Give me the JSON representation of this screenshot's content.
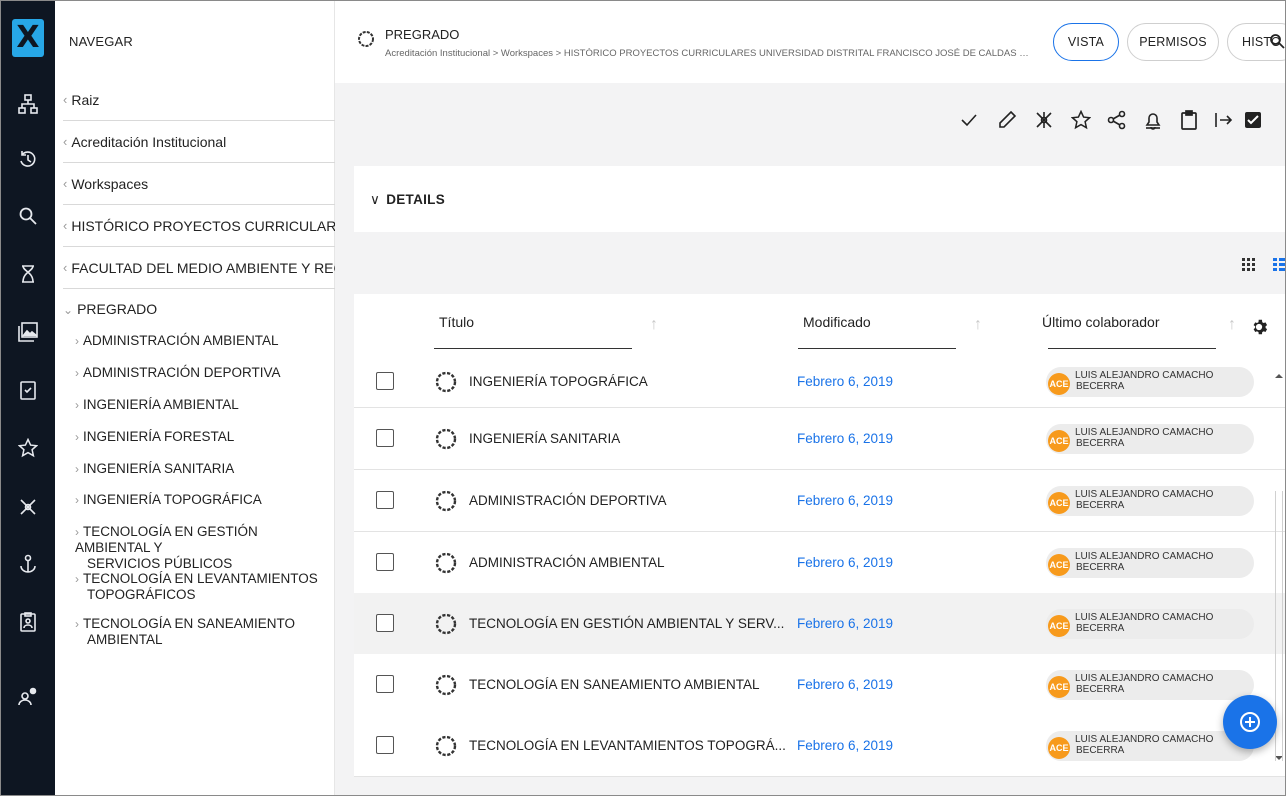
{
  "rail": {
    "logo": "X",
    "icons": [
      "hierarchy-icon",
      "history-icon",
      "search-icon",
      "hourglass-icon",
      "gallery-icon",
      "checklist-icon",
      "star-icon",
      "network-icon",
      "anchor-user-icon",
      "clipboard-id-icon",
      "user-settings-icon"
    ]
  },
  "navigator": {
    "title": "NAVEGAR",
    "breadcrumbs": [
      {
        "label": "Raiz"
      },
      {
        "label": "Acreditación Institucional"
      },
      {
        "label": "Workspaces"
      },
      {
        "label": "HISTÓRICO PROYECTOS CURRICULARES U..."
      },
      {
        "label": "FACULTAD DEL MEDIO AMBIENTE Y RECU..."
      }
    ],
    "current": "PREGRADO",
    "children": [
      {
        "line1": "ADMINISTRACIÓN AMBIENTAL",
        "line2": ""
      },
      {
        "line1": "ADMINISTRACIÓN DEPORTIVA",
        "line2": ""
      },
      {
        "line1": "INGENIERÍA AMBIENTAL",
        "line2": ""
      },
      {
        "line1": "INGENIERÍA FORESTAL",
        "line2": ""
      },
      {
        "line1": "INGENIERÍA SANITARIA",
        "line2": ""
      },
      {
        "line1": "INGENIERÍA TOPOGRÁFICA",
        "line2": ""
      },
      {
        "line1": "TECNOLOGÍA EN GESTIÓN AMBIENTAL Y",
        "line2": "SERVICIOS PÚBLICOS"
      },
      {
        "line1": "TECNOLOGÍA EN LEVANTAMIENTOS",
        "line2": "TOPOGRÁFICOS"
      },
      {
        "line1": "TECNOLOGÍA EN SANEAMIENTO",
        "line2": "AMBIENTAL"
      }
    ]
  },
  "header": {
    "title": "PREGRADO",
    "path": "Acreditación Institucional > Workspaces > HISTÓRICO PROYECTOS CURRICULARES UNIVERSIDAD DISTRITAL FRANCISCO JOSÉ DE CALDAS > FACULTA...",
    "tabs": [
      {
        "label": "VISTA",
        "active": true
      },
      {
        "label": "PERMISOS",
        "active": false
      },
      {
        "label": "HISTO",
        "active": false
      }
    ]
  },
  "actions": [
    "check-icon",
    "pencil-icon",
    "network-icon",
    "star-icon",
    "share-icon",
    "bell-icon",
    "clipboard-icon",
    "export-icon",
    "checkbox-checked-icon"
  ],
  "details": {
    "label": "DETAILS"
  },
  "table": {
    "columns": {
      "title": "Título",
      "modified": "Modificado",
      "collaborator": "Último colaborador"
    },
    "rows": [
      {
        "title": "INGENIERÍA TOPOGRÁFICA",
        "modified": "Febrero 6, 2019",
        "initials": "ACE",
        "collab1": "LUIS ALEJANDRO CAMACHO",
        "collab2": "BECERRA"
      },
      {
        "title": "INGENIERÍA SANITARIA",
        "modified": "Febrero 6, 2019",
        "initials": "ACE",
        "collab1": "LUIS ALEJANDRO CAMACHO",
        "collab2": "BECERRA"
      },
      {
        "title": "ADMINISTRACIÓN DEPORTIVA",
        "modified": "Febrero 6, 2019",
        "initials": "ACE",
        "collab1": "LUIS ALEJANDRO CAMACHO",
        "collab2": "BECERRA"
      },
      {
        "title": "ADMINISTRACIÓN AMBIENTAL",
        "modified": "Febrero 6, 2019",
        "initials": "ACE",
        "collab1": "LUIS ALEJANDRO CAMACHO",
        "collab2": "BECERRA"
      },
      {
        "title": "TECNOLOGÍA EN GESTIÓN AMBIENTAL Y SERV...",
        "modified": "Febrero 6, 2019",
        "initials": "ACE",
        "collab1": "LUIS ALEJANDRO CAMACHO",
        "collab2": "BECERRA"
      },
      {
        "title": "TECNOLOGÍA EN SANEAMIENTO AMBIENTAL",
        "modified": "Febrero 6, 2019",
        "initials": "ACE",
        "collab1": "LUIS ALEJANDRO CAMACHO",
        "collab2": "BECERRA"
      },
      {
        "title": "TECNOLOGÍA EN LEVANTAMIENTOS TOPOGRÁ...",
        "modified": "Febrero 6, 2019",
        "initials": "ACE",
        "collab1": "LUIS ALEJANDRO CAMACHO",
        "collab2": "BECERRA"
      }
    ]
  },
  "colors": {
    "accent": "#1a73e8",
    "rail": "#0e1622",
    "logo": "#27a7e7",
    "avatar": "#f79a1c"
  },
  "fab": {
    "icon": "add-circle-icon"
  }
}
